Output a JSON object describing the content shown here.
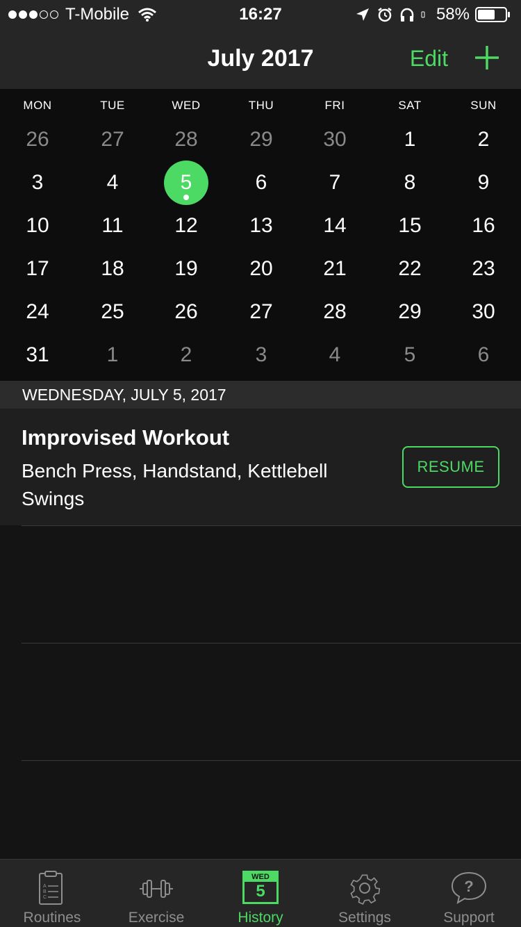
{
  "status_bar": {
    "carrier": "T-Mobile",
    "time": "16:27",
    "battery": "58%"
  },
  "nav": {
    "title": "July 2017",
    "edit_label": "Edit"
  },
  "calendar": {
    "weekdays": [
      "MON",
      "TUE",
      "WED",
      "THU",
      "FRI",
      "SAT",
      "SUN"
    ],
    "weeks": [
      [
        "26",
        "27",
        "28",
        "29",
        "30",
        "1",
        "2"
      ],
      [
        "3",
        "4",
        "5",
        "6",
        "7",
        "8",
        "9"
      ],
      [
        "10",
        "11",
        "12",
        "13",
        "14",
        "15",
        "16"
      ],
      [
        "17",
        "18",
        "19",
        "20",
        "21",
        "22",
        "23"
      ],
      [
        "24",
        "25",
        "26",
        "27",
        "28",
        "29",
        "30"
      ],
      [
        "31",
        "1",
        "2",
        "3",
        "4",
        "5",
        "6"
      ]
    ],
    "selected_day": "5",
    "accent_color": "#4cd964"
  },
  "selected_date_header": "WEDNESDAY, JULY 5, 2017",
  "workout": {
    "title": "Improvised Workout",
    "exercises": "Bench Press, Handstand, Kettlebell Swings",
    "resume_label": "RESUME"
  },
  "tabs": [
    {
      "label": "Routines",
      "icon": "clipboard-icon"
    },
    {
      "label": "Exercise",
      "icon": "dumbbell-icon"
    },
    {
      "label": "History",
      "icon": "calendar-icon",
      "cal_day": "WED",
      "cal_num": "5"
    },
    {
      "label": "Settings",
      "icon": "gear-icon"
    },
    {
      "label": "Support",
      "icon": "question-bubble-icon"
    }
  ]
}
